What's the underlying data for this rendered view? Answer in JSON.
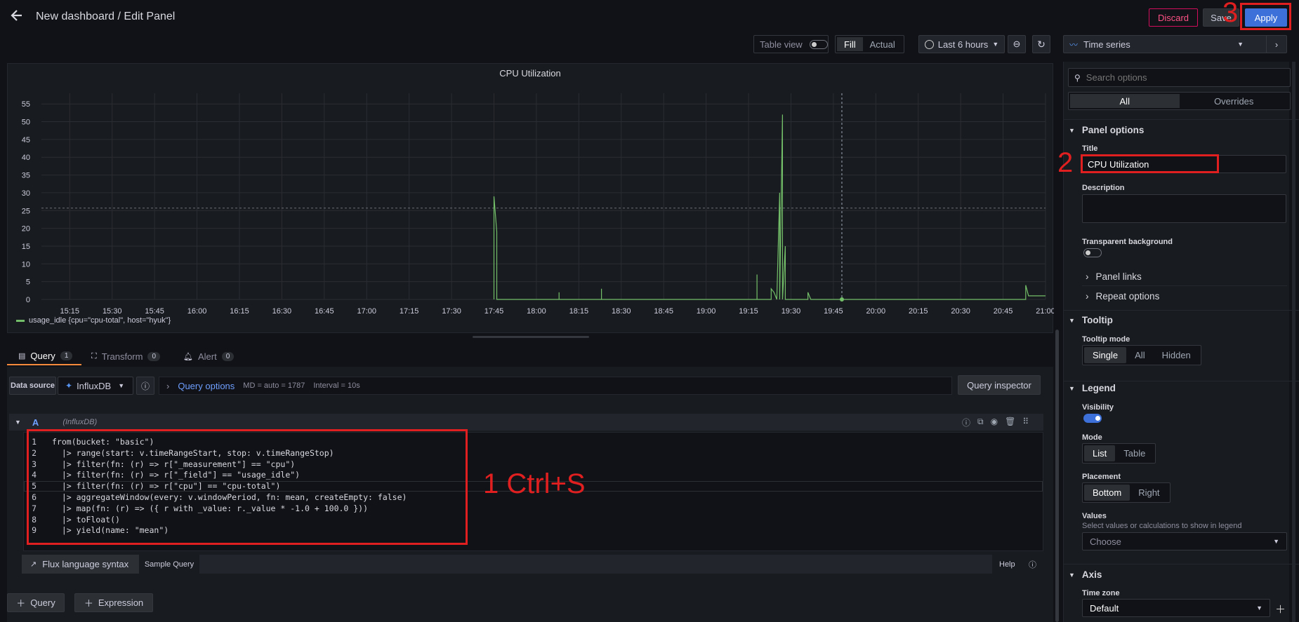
{
  "header": {
    "breadcrumb": "New dashboard / Edit Panel",
    "discard": "Discard",
    "save": "Save",
    "apply": "Apply"
  },
  "toolbar": {
    "table_view": "Table view",
    "fill": "Fill",
    "actual": "Actual",
    "time_range": "Last 6 hours",
    "viz_type": "Time series"
  },
  "chart_data": {
    "type": "line",
    "title": "CPU Utilization",
    "y_ticks": [
      "55",
      "50",
      "45",
      "40",
      "35",
      "30",
      "25",
      "20",
      "15",
      "10",
      "5",
      "0"
    ],
    "ylim": [
      0,
      58
    ],
    "x_ticks": [
      "15:15",
      "15:30",
      "15:45",
      "16:00",
      "16:15",
      "16:30",
      "16:45",
      "17:00",
      "17:15",
      "17:30",
      "17:45",
      "18:00",
      "18:15",
      "18:30",
      "18:45",
      "19:00",
      "19:15",
      "19:30",
      "19:45",
      "20:00",
      "20:15",
      "20:30",
      "20:45",
      "21:00"
    ],
    "series": [
      {
        "name": "usage_idle {cpu=\"cpu-total\", host=\"hyuk\"}",
        "color": "#73bf69",
        "points": [
          [
            "17:45",
            0
          ],
          [
            "17:45",
            29
          ],
          [
            "17:46",
            19
          ],
          [
            "17:46",
            0
          ],
          [
            "18:08",
            0
          ],
          [
            "18:08",
            2
          ],
          [
            "18:08",
            0
          ],
          [
            "18:23",
            0
          ],
          [
            "18:23",
            3
          ],
          [
            "18:23",
            0
          ],
          [
            "19:18",
            0
          ],
          [
            "19:18",
            7
          ],
          [
            "19:18",
            0
          ],
          [
            "19:23",
            0
          ],
          [
            "19:23",
            3
          ],
          [
            "19:24",
            2
          ],
          [
            "19:25",
            0
          ],
          [
            "19:26",
            30
          ],
          [
            "19:26",
            0
          ],
          [
            "19:27",
            52
          ],
          [
            "19:27",
            0
          ],
          [
            "19:28",
            15
          ],
          [
            "19:28",
            0
          ],
          [
            "19:36",
            0
          ],
          [
            "19:36",
            2
          ],
          [
            "19:37",
            0
          ],
          [
            "20:53",
            0
          ],
          [
            "20:53",
            4
          ],
          [
            "20:54",
            1
          ],
          [
            "21:00",
            1
          ]
        ]
      }
    ],
    "threshold_y": 25.7,
    "hover_x": "19:48",
    "grid": true,
    "legend_position": "bottom"
  },
  "query_tabs": {
    "query": "Query",
    "query_count": "1",
    "transform": "Transform",
    "transform_count": "0",
    "alert": "Alert",
    "alert_count": "0"
  },
  "datasource": {
    "label": "Data source",
    "name": "InfluxDB",
    "query_options": "Query options",
    "md": "MD = auto = 1787",
    "interval": "Interval = 10s",
    "inspector": "Query inspector"
  },
  "query_row": {
    "ref": "A",
    "source": "(InfluxDB)",
    "lines": [
      {
        "n": "1",
        "t": "from(bucket: \"basic\")"
      },
      {
        "n": "2",
        "t": "  |> range(start: v.timeRangeStart, stop: v.timeRangeStop)"
      },
      {
        "n": "3",
        "t": "  |> filter(fn: (r) => r[\"_measurement\"] == \"cpu\")"
      },
      {
        "n": "4",
        "t": "  |> filter(fn: (r) => r[\"_field\"] == \"usage_idle\")"
      },
      {
        "n": "5",
        "t": "  |> filter(fn: (r) => r[\"cpu\"] == \"cpu-total\")"
      },
      {
        "n": "6",
        "t": "  |> aggregateWindow(every: v.windowPeriod, fn: mean, createEmpty: false)"
      },
      {
        "n": "7",
        "t": "  |> map(fn: (r) => ({ r with _value: r._value * -1.0 + 100.0 }))"
      },
      {
        "n": "8",
        "t": "  |> toFloat()"
      },
      {
        "n": "9",
        "t": "  |> yield(name: \"mean\")"
      }
    ],
    "flux_syntax": "Flux language syntax",
    "sample_query": "Sample Query",
    "help": "Help"
  },
  "bottom_buttons": {
    "query": "Query",
    "expression": "Expression"
  },
  "options": {
    "search_placeholder": "Search options",
    "all": "All",
    "overrides": "Overrides",
    "panel_options": "Panel options",
    "title_label": "Title",
    "title_value": "CPU Utilization",
    "description_label": "Description",
    "transparent_label": "Transparent background",
    "panel_links": "Panel links",
    "repeat_options": "Repeat options",
    "tooltip": "Tooltip",
    "tooltip_mode": "Tooltip mode",
    "tooltip_modes": [
      "Single",
      "All",
      "Hidden"
    ],
    "legend": "Legend",
    "visibility": "Visibility",
    "mode": "Mode",
    "modes": [
      "List",
      "Table"
    ],
    "placement": "Placement",
    "placements": [
      "Bottom",
      "Right"
    ],
    "values": "Values",
    "values_desc": "Select values or calculations to show in legend",
    "choose": "Choose",
    "axis": "Axis",
    "time_zone": "Time zone",
    "time_zone_value": "Default"
  },
  "annotations": {
    "a1": "1 Ctrl+S",
    "a2": "2",
    "a3": "3"
  }
}
